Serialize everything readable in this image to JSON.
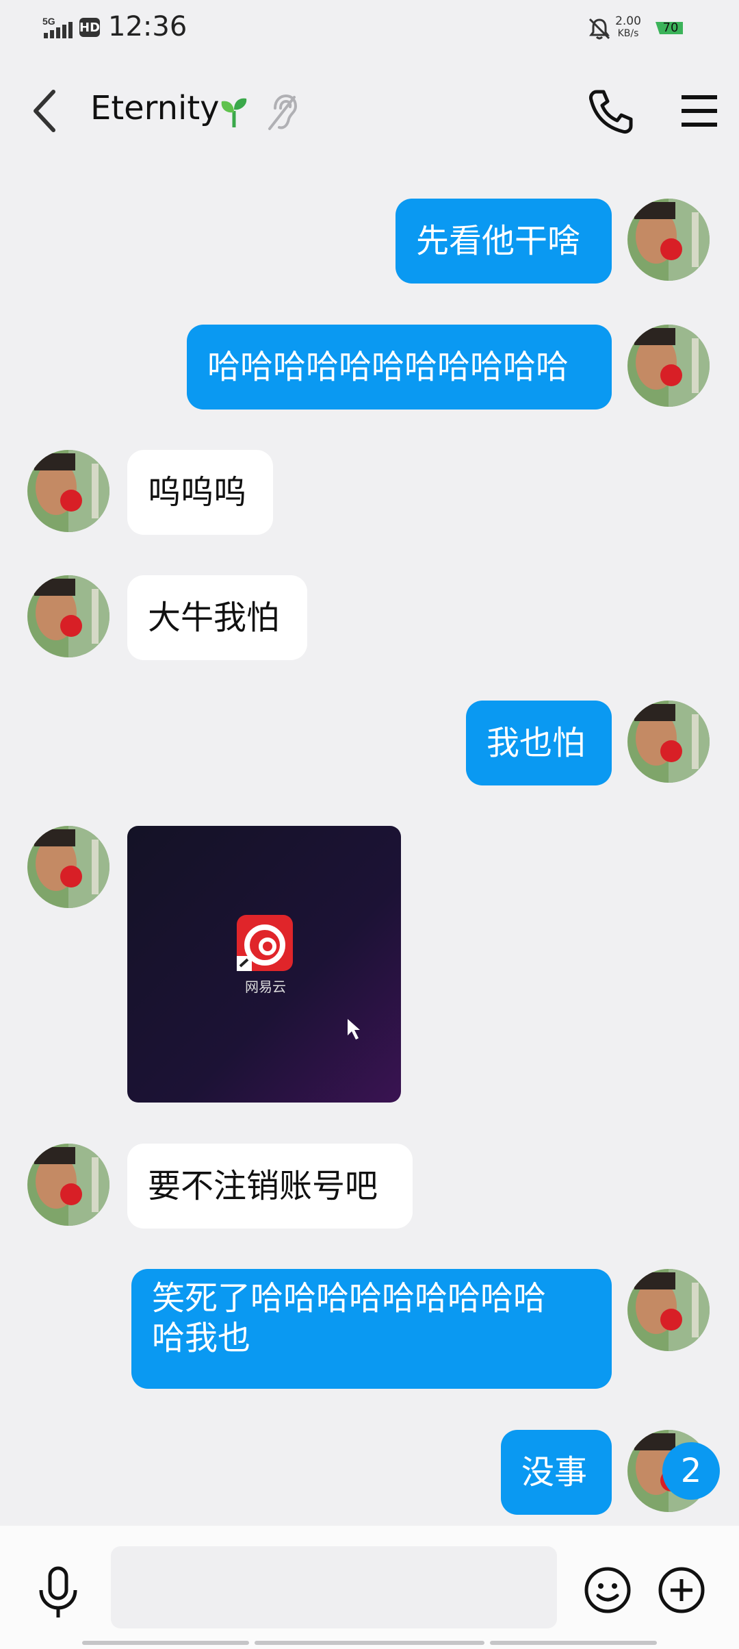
{
  "status_bar": {
    "network": "5G",
    "hd": "HD",
    "time": "12:36",
    "speed_value": "2.00",
    "speed_unit": "KB/s",
    "battery": "70"
  },
  "header": {
    "title": "Eternity",
    "icons": [
      "back-chevron",
      "sprout",
      "ear",
      "phone",
      "menu"
    ]
  },
  "messages": [
    {
      "side": "out",
      "text": "先看他干啥"
    },
    {
      "side": "out",
      "text": "哈哈哈哈哈哈哈哈哈哈哈"
    },
    {
      "side": "in",
      "text": "呜呜呜"
    },
    {
      "side": "in",
      "text": "大牛我怕"
    },
    {
      "side": "out",
      "text": "我也怕"
    },
    {
      "side": "in",
      "type": "image",
      "caption": "网易云"
    },
    {
      "side": "in",
      "text": "要不注销账号吧"
    },
    {
      "side": "out",
      "text": "笑死了哈哈哈哈哈哈哈哈哈哈我也"
    },
    {
      "side": "out",
      "text": "没事"
    }
  ],
  "unread_count": "2",
  "input": {
    "placeholder": "",
    "icons": [
      "microphone",
      "emoji",
      "plus"
    ]
  },
  "colors": {
    "outgoing_bubble": "#0a99f2",
    "incoming_bubble": "#ffffff",
    "background": "#f0f0f2"
  }
}
